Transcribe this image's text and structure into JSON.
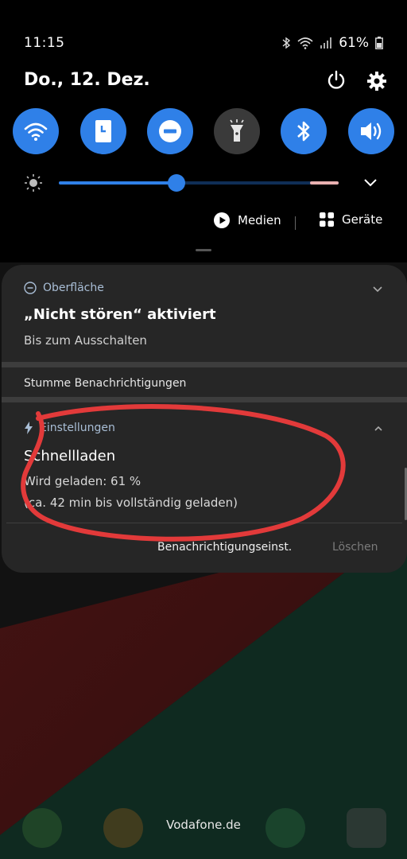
{
  "status_bar": {
    "time": "11:15",
    "battery_percent": "61%",
    "icons": [
      "bluetooth-icon",
      "wifi-icon",
      "signal-icon",
      "battery-icon"
    ]
  },
  "header": {
    "date": "Do., 12. Dez.",
    "power_icon": "power-icon",
    "settings_icon": "gear-icon"
  },
  "quick_settings": [
    {
      "name": "wifi",
      "icon": "wifi-icon",
      "active": true
    },
    {
      "name": "screen-lock",
      "icon": "phone-portrait-icon",
      "active": true
    },
    {
      "name": "do-not-disturb",
      "icon": "minus-circle-icon",
      "active": true
    },
    {
      "name": "flashlight",
      "icon": "flashlight-icon",
      "active": false
    },
    {
      "name": "bluetooth",
      "icon": "bluetooth-icon",
      "active": true
    },
    {
      "name": "sound",
      "icon": "speaker-icon",
      "active": true
    }
  ],
  "brightness": {
    "level": 0.42
  },
  "media_row": {
    "media_label": "Medien",
    "devices_label": "Geräte"
  },
  "notifications": {
    "group1": {
      "app": "Oberfläche",
      "title": "„Nicht stören“ aktiviert",
      "text": "Bis zum Ausschalten"
    },
    "silent_header": "Stumme Benachrichtigungen",
    "group2": {
      "app": "Einstellungen",
      "title": "Schnellladen",
      "line1": "Wird geladen: 61 %",
      "line2": "(ca. 42 min bis vollständig geladen)",
      "action_settings": "Benachrichtigungseinst.",
      "action_clear": "Löschen"
    }
  },
  "home": {
    "carrier": "Vodafone.de"
  },
  "colors": {
    "accent": "#2f80e8",
    "scribble": "#e23a3a",
    "panel": "#262626"
  }
}
